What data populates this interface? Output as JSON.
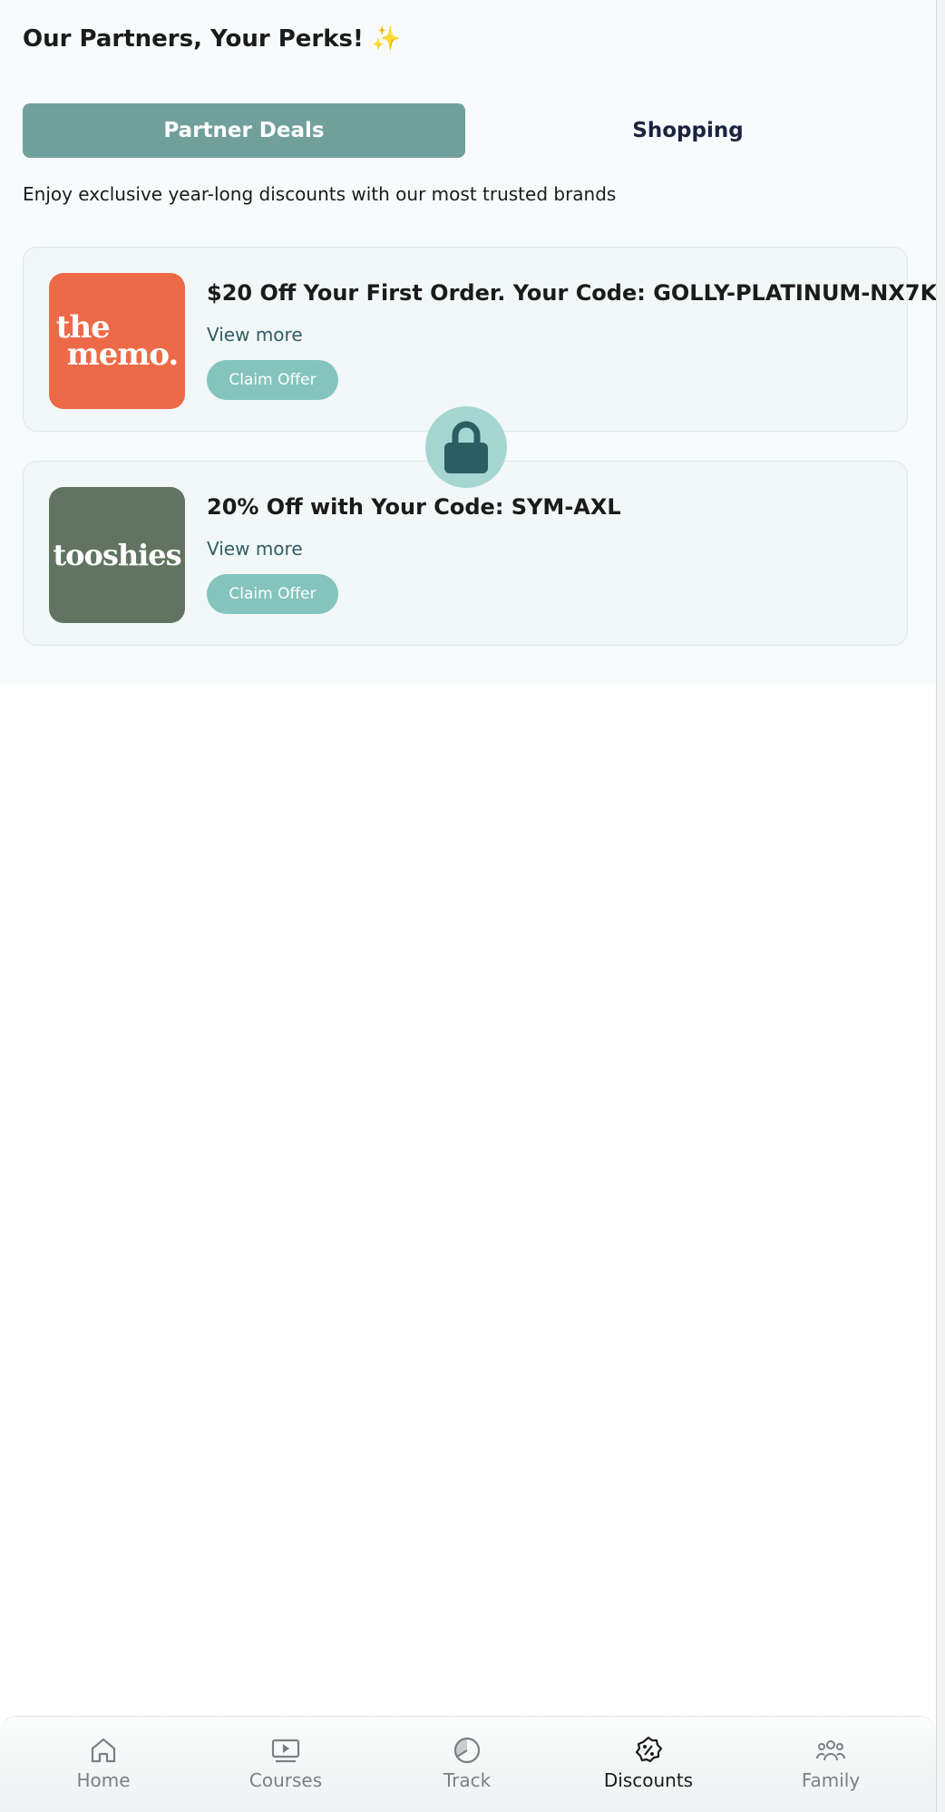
{
  "header": {
    "title": "Our Partners, Your Perks!",
    "title_emoji": "✨"
  },
  "tabs": [
    {
      "label": "Partner Deals",
      "active": true
    },
    {
      "label": "Shopping",
      "active": false
    }
  ],
  "subtitle": "Enjoy exclusive year-long discounts with our most trusted brands",
  "offers": [
    {
      "brand": "the memo.",
      "logo_line1": "the",
      "logo_line2": "memo.",
      "logo_color": "#ed6a48",
      "title": "$20 Off Your First Order. Your Code: GOLLY-PLATINUM-NX7K",
      "view_more": "View more",
      "claim": "Claim Offer"
    },
    {
      "brand": "tooshies",
      "logo_text": "tooshies",
      "logo_color": "#627461",
      "title": "20% Off with Your Code: SYM-AXL",
      "view_more": "View more",
      "claim": "Claim Offer"
    }
  ],
  "lock": {
    "icon": "lock-icon"
  },
  "nav": [
    {
      "label": "Home",
      "icon": "home-icon",
      "active": false
    },
    {
      "label": "Courses",
      "icon": "video-icon",
      "active": false
    },
    {
      "label": "Track",
      "icon": "pie-chart-icon",
      "active": false
    },
    {
      "label": "Discounts",
      "icon": "discount-badge-icon",
      "active": true
    },
    {
      "label": "Family",
      "icon": "family-icon",
      "active": false
    }
  ],
  "colors": {
    "accent": "#71a09c",
    "button": "#84c4bd",
    "lock_bg": "#a6d6d2",
    "lock_fg": "#2a5e63"
  }
}
